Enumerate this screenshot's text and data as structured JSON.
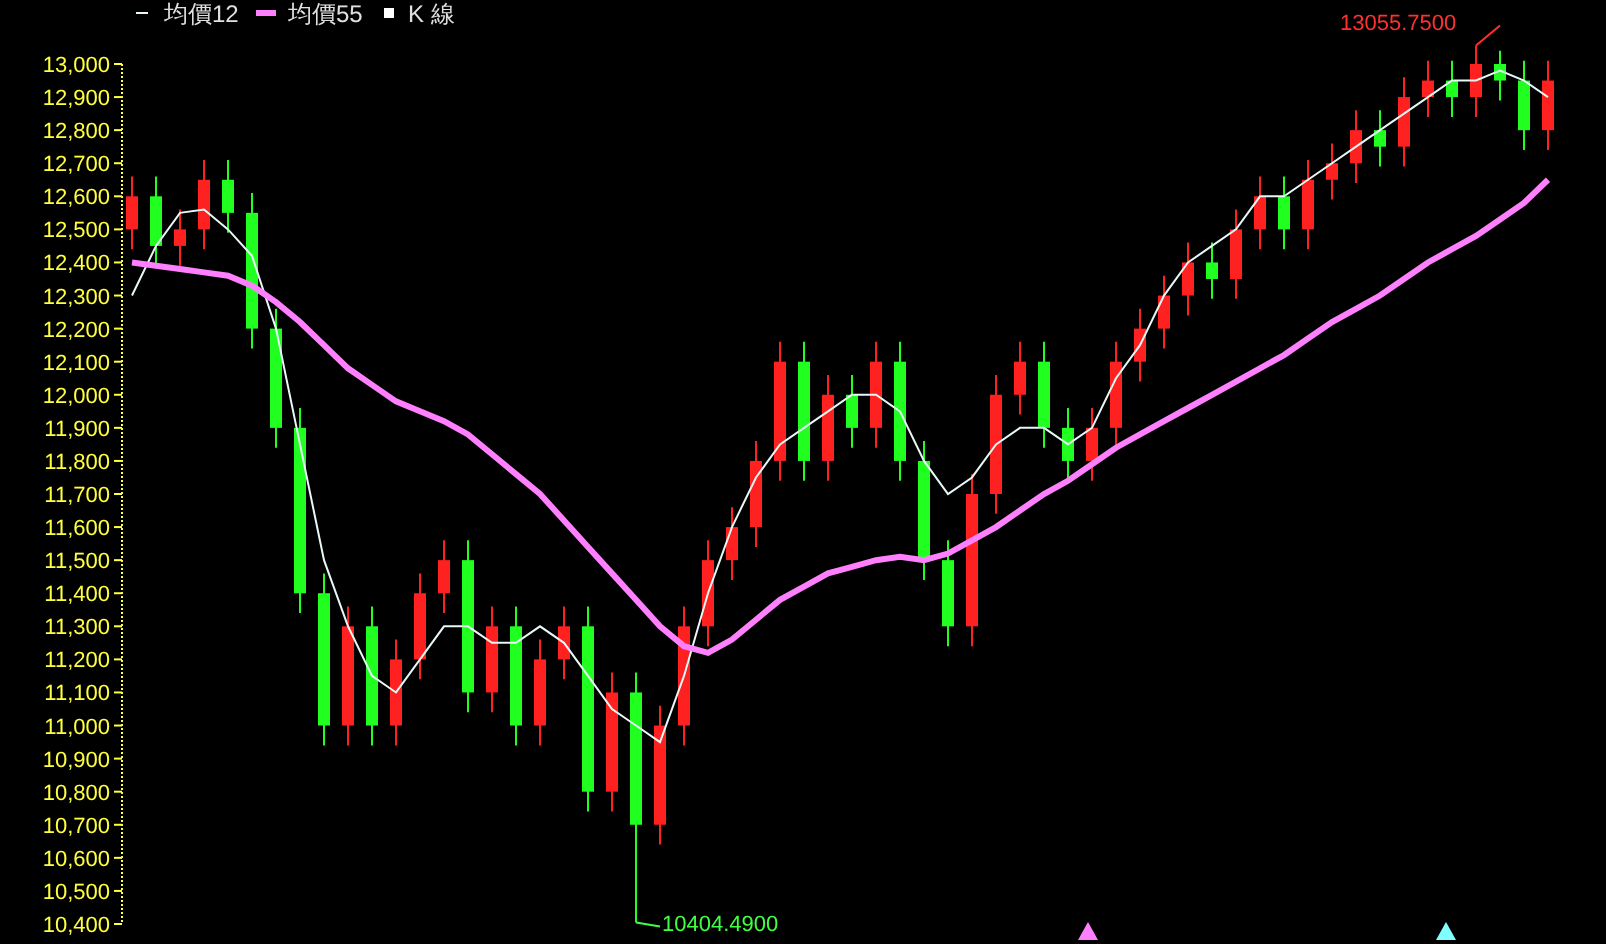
{
  "chart_data": {
    "type": "candlestick",
    "ohlc": [
      [
        12500,
        12660,
        12440,
        12600
      ],
      [
        12600,
        12660,
        12390,
        12450
      ],
      [
        12450,
        12560,
        12390,
        12500
      ],
      [
        12500,
        12710,
        12440,
        12650
      ],
      [
        12650,
        12710,
        12490,
        12550
      ],
      [
        12550,
        12610,
        12140,
        12200
      ],
      [
        12200,
        12260,
        11840,
        11900
      ],
      [
        11900,
        11960,
        11340,
        11400
      ],
      [
        11400,
        11460,
        10940,
        11000
      ],
      [
        11000,
        11360,
        10940,
        11300
      ],
      [
        11300,
        11360,
        10940,
        11000
      ],
      [
        11000,
        11260,
        10940,
        11200
      ],
      [
        11200,
        11460,
        11140,
        11400
      ],
      [
        11400,
        11560,
        11340,
        11500
      ],
      [
        11500,
        11560,
        11040,
        11100
      ],
      [
        11100,
        11360,
        11040,
        11300
      ],
      [
        11300,
        11360,
        10940,
        11000
      ],
      [
        11000,
        11260,
        10940,
        11200
      ],
      [
        11200,
        11360,
        11140,
        11300
      ],
      [
        11300,
        11360,
        10740,
        10800
      ],
      [
        10800,
        11160,
        10740,
        11100
      ],
      [
        11100,
        11160,
        10404.49,
        10700
      ],
      [
        10700,
        11060,
        10640,
        11000
      ],
      [
        11000,
        11360,
        10940,
        11300
      ],
      [
        11300,
        11560,
        11240,
        11500
      ],
      [
        11500,
        11660,
        11440,
        11600
      ],
      [
        11600,
        11860,
        11540,
        11800
      ],
      [
        11800,
        12160,
        11740,
        12100
      ],
      [
        12100,
        12160,
        11740,
        11800
      ],
      [
        11800,
        12060,
        11740,
        12000
      ],
      [
        12000,
        12060,
        11840,
        11900
      ],
      [
        11900,
        12160,
        11840,
        12100
      ],
      [
        12100,
        12160,
        11740,
        11800
      ],
      [
        11800,
        11860,
        11440,
        11500
      ],
      [
        11500,
        11560,
        11240,
        11300
      ],
      [
        11300,
        11760,
        11240,
        11700
      ],
      [
        11700,
        12060,
        11640,
        12000
      ],
      [
        12000,
        12160,
        11940,
        12100
      ],
      [
        12100,
        12160,
        11840,
        11900
      ],
      [
        11900,
        11960,
        11740,
        11800
      ],
      [
        11800,
        11960,
        11740,
        11900
      ],
      [
        11900,
        12160,
        11840,
        12100
      ],
      [
        12100,
        12260,
        12040,
        12200
      ],
      [
        12200,
        12360,
        12140,
        12300
      ],
      [
        12300,
        12460,
        12240,
        12400
      ],
      [
        12400,
        12460,
        12290,
        12350
      ],
      [
        12350,
        12560,
        12290,
        12500
      ],
      [
        12500,
        12660,
        12440,
        12600
      ],
      [
        12600,
        12660,
        12440,
        12500
      ],
      [
        12500,
        12710,
        12440,
        12650
      ],
      [
        12650,
        12760,
        12590,
        12700
      ],
      [
        12700,
        12860,
        12640,
        12800
      ],
      [
        12800,
        12860,
        12690,
        12750
      ],
      [
        12750,
        12960,
        12690,
        12900
      ],
      [
        12900,
        13010,
        12840,
        12950
      ],
      [
        12950,
        13010,
        12840,
        12900
      ],
      [
        12900,
        13055.75,
        12840,
        13000
      ],
      [
        13000,
        13040,
        12890,
        12950
      ],
      [
        12950,
        13010,
        12740,
        12800
      ],
      [
        12800,
        13010,
        12740,
        12950
      ]
    ],
    "series": [
      {
        "name": "均價12",
        "type": "line",
        "color": "#e8f8f8",
        "values": [
          12300,
          12450,
          12550,
          12560,
          12500,
          12420,
          12200,
          11850,
          11500,
          11300,
          11150,
          11100,
          11200,
          11300,
          11300,
          11250,
          11250,
          11300,
          11250,
          11150,
          11050,
          11000,
          10950,
          11150,
          11400,
          11600,
          11750,
          11850,
          11900,
          11950,
          12000,
          12000,
          11950,
          11800,
          11700,
          11750,
          11850,
          11900,
          11900,
          11850,
          11900,
          12050,
          12150,
          12300,
          12400,
          12450,
          12500,
          12600,
          12600,
          12650,
          12700,
          12750,
          12800,
          12850,
          12900,
          12950,
          12950,
          12980,
          12950,
          12900
        ]
      },
      {
        "name": "均價55",
        "type": "line",
        "color": "#ff80ff",
        "values": [
          12400,
          12390,
          12380,
          12370,
          12360,
          12330,
          12280,
          12220,
          12150,
          12080,
          12030,
          11980,
          11950,
          11920,
          11880,
          11820,
          11760,
          11700,
          11620,
          11540,
          11460,
          11380,
          11300,
          11240,
          11220,
          11260,
          11320,
          11380,
          11420,
          11460,
          11480,
          11500,
          11510,
          11500,
          11520,
          11560,
          11600,
          11650,
          11700,
          11740,
          11790,
          11840,
          11880,
          11920,
          11960,
          12000,
          12040,
          12080,
          12120,
          12170,
          12220,
          12260,
          12300,
          12350,
          12400,
          12440,
          12480,
          12530,
          12580,
          12650
        ]
      }
    ],
    "legend": {
      "ohlc_label": "K 線"
    },
    "ylim": [
      10400,
      13000
    ],
    "yticks": [
      {
        "value": 13000,
        "label": "13,000"
      },
      {
        "value": 12900,
        "label": "12,900"
      },
      {
        "value": 12800,
        "label": "12,800"
      },
      {
        "value": 12700,
        "label": "12,700"
      },
      {
        "value": 12600,
        "label": "12,600"
      },
      {
        "value": 12500,
        "label": "12,500"
      },
      {
        "value": 12400,
        "label": "12,400"
      },
      {
        "value": 12300,
        "label": "12,300"
      },
      {
        "value": 12200,
        "label": "12,200"
      },
      {
        "value": 12100,
        "label": "12,100"
      },
      {
        "value": 12000,
        "label": "12,000"
      },
      {
        "value": 11900,
        "label": "11,900"
      },
      {
        "value": 11800,
        "label": "11,800"
      },
      {
        "value": 11700,
        "label": "11,700"
      },
      {
        "value": 11600,
        "label": "11,600"
      },
      {
        "value": 11500,
        "label": "11,500"
      },
      {
        "value": 11400,
        "label": "11,400"
      },
      {
        "value": 11300,
        "label": "11,300"
      },
      {
        "value": 11200,
        "label": "11,200"
      },
      {
        "value": 11100,
        "label": "11,100"
      },
      {
        "value": 11000,
        "label": "11,000"
      },
      {
        "value": 10900,
        "label": "10,900"
      },
      {
        "value": 10800,
        "label": "10,800"
      },
      {
        "value": 10700,
        "label": "10,700"
      },
      {
        "value": 10600,
        "label": "10,600"
      },
      {
        "value": 10500,
        "label": "10,500"
      },
      {
        "value": 10400,
        "label": "10,400"
      }
    ],
    "annotations": [
      "13055.7500",
      "10404.4900"
    ]
  }
}
